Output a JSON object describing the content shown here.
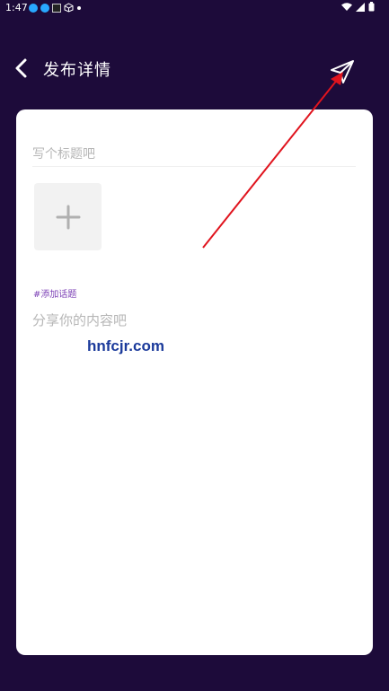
{
  "status_bar": {
    "time": "1:47"
  },
  "header": {
    "title": "发布详情",
    "back_icon": "chevron-left-icon",
    "send_icon": "paper-plane-icon"
  },
  "form": {
    "title_placeholder": "写个标题吧",
    "add_image_icon": "plus-icon",
    "topic_label": "#添加话题",
    "content_placeholder": "分享你的内容吧"
  },
  "watermark": {
    "text": "hnfcjr.com"
  },
  "colors": {
    "background": "#1d0b3a",
    "card": "#ffffff",
    "topic": "#7b3fb5",
    "annotation_arrow": "#e0141e",
    "watermark": "#1b3a9b"
  }
}
